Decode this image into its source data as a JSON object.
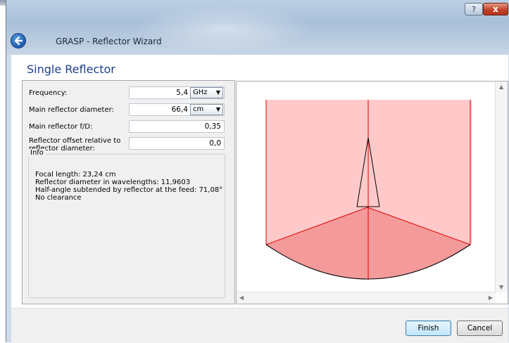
{
  "window": {
    "title": "GRASP - Reflector Wizard",
    "help_label": "?",
    "close_label": "x"
  },
  "page": {
    "title": "Single Reflector"
  },
  "fields": {
    "frequency": {
      "label": "Frequency:",
      "value": "5,4",
      "unit": "GHz"
    },
    "diameter": {
      "label": "Main reflector diameter:",
      "value": "66,4",
      "unit": "cm"
    },
    "fd": {
      "label": "Main reflector f/D:",
      "value": "0,35"
    },
    "offset": {
      "label_line1": "Reflector offset relative to",
      "label_line2": "reflector diameter:",
      "value": "0,0"
    }
  },
  "info": {
    "legend": "Info",
    "lines": [
      "Focal length: 23,24 cm",
      "Reflector diameter in wavelengths: 11,9603",
      "Half-angle subtended by reflector at the feed: 71,08°",
      "No clearance"
    ]
  },
  "buttons": {
    "finish": "Finish",
    "cancel": "Cancel"
  },
  "colors": {
    "accent": "#1e3f8a",
    "region_light": "#ffc9c9",
    "region_dark": "#f49a9a",
    "ray": "#e00000"
  }
}
